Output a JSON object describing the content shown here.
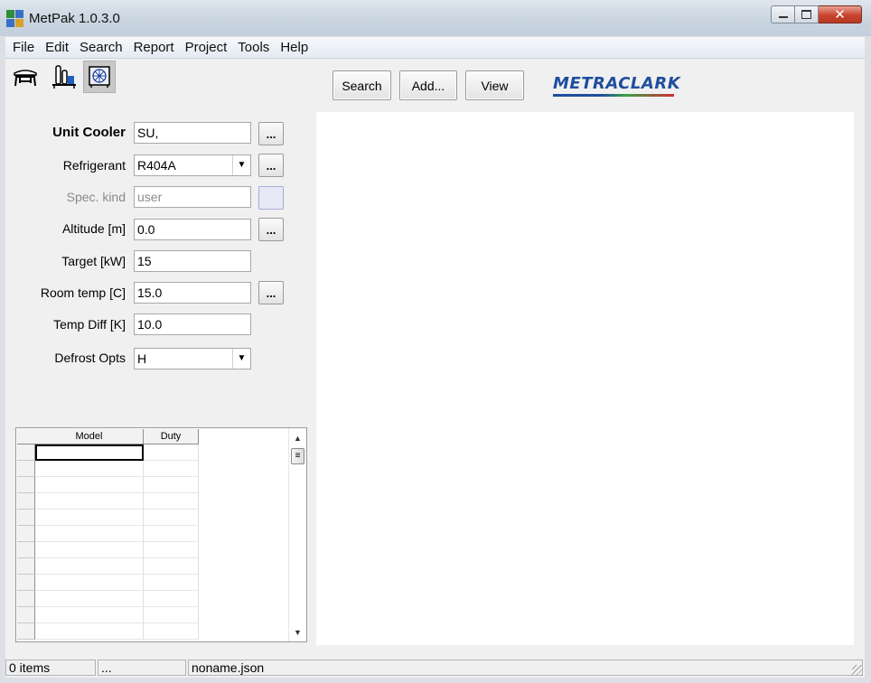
{
  "window": {
    "title": "MetPak 1.0.3.0"
  },
  "menu": [
    "File",
    "Edit",
    "Search",
    "Report",
    "Project",
    "Tools",
    "Help"
  ],
  "toolbar": {
    "mode_icons": [
      {
        "name": "condenser-unit-icon",
        "active": false
      },
      {
        "name": "compressor-unit-icon",
        "active": false
      },
      {
        "name": "unit-cooler-icon",
        "active": true
      }
    ],
    "search_label": "Search",
    "add_label": "Add...",
    "view_label": "View",
    "logo": "METRACLARK"
  },
  "form": {
    "unit_cooler": {
      "label": "Unit Cooler",
      "value": "SU,"
    },
    "refrigerant": {
      "label": "Refrigerant",
      "value": "R404A"
    },
    "spec_kind": {
      "label": "Spec. kind",
      "value": "user"
    },
    "altitude": {
      "label": "Altitude [m]",
      "value": "0.0"
    },
    "target": {
      "label": "Target [kW]",
      "value": "15"
    },
    "room_temp": {
      "label": "Room temp [C]",
      "value": "15.0"
    },
    "temp_diff": {
      "label": "Temp Diff [K]",
      "value": "10.0"
    },
    "defrost": {
      "label": "Defrost Opts",
      "value": "H"
    },
    "browse_label": "..."
  },
  "grid": {
    "columns": [
      "Model",
      "Duty"
    ],
    "rows": []
  },
  "status": {
    "items": "0 items",
    "info": "...",
    "file": "noname.json"
  },
  "colors": {
    "logo_blue": "#1f4e9d",
    "close_red": "#c8452f"
  }
}
